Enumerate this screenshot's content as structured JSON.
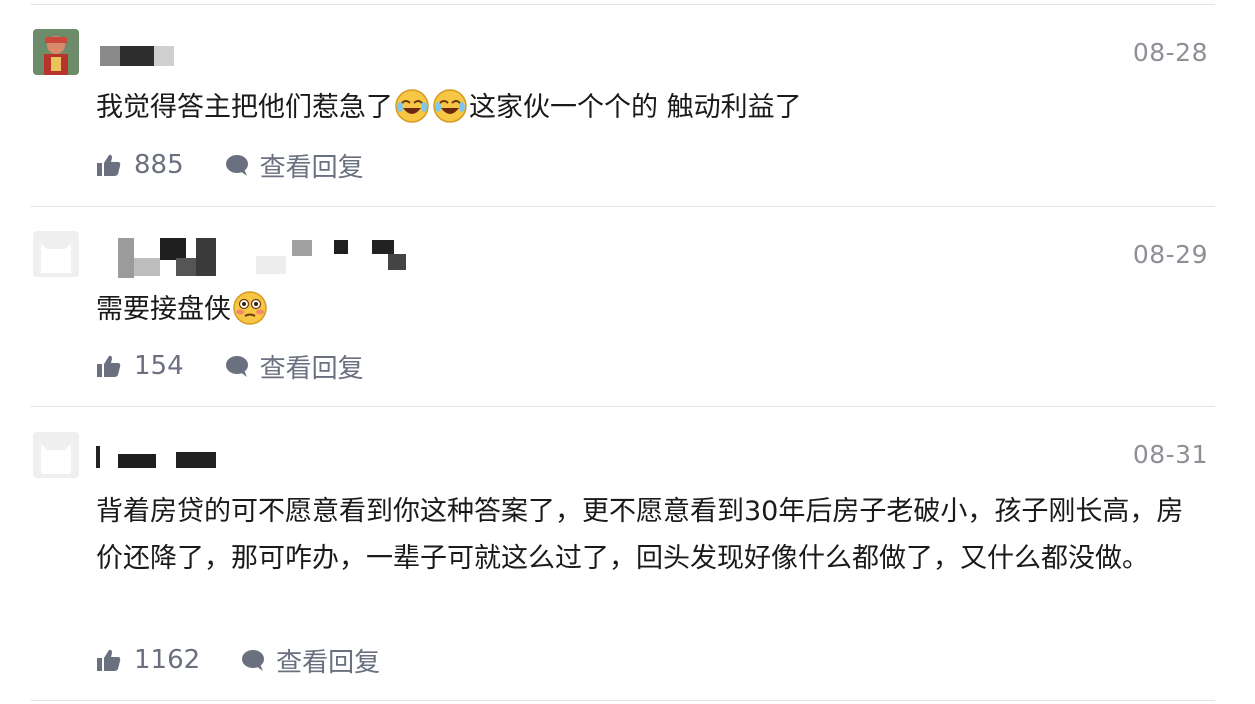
{
  "comments": [
    {
      "date": "08-28",
      "text_before": "我觉得答主把他们惹急了",
      "emojis": [
        "laugh-cry-emoji",
        "laugh-cry-emoji"
      ],
      "text_after": "这家伙一个个的 触动利益了",
      "likes": "885",
      "reply_label": "查看回复"
    },
    {
      "date": "08-29",
      "text_before": "需要接盘侠",
      "emojis": [
        "flushed-emoji"
      ],
      "text_after": "",
      "likes": "154",
      "reply_label": "查看回复"
    },
    {
      "date": "08-31",
      "text_before": "背着房贷的可不愿意看到你这种答案了，更不愿意看到30年后房子老破小，孩子刚长高，房价还降了，那可咋办，一辈子可就这么过了，回头发现好像什么都做了，又什么都没做。",
      "emojis": [],
      "text_after": "",
      "likes": "1162",
      "reply_label": "查看回复"
    }
  ],
  "colors": {
    "meta_gray": "#8e9097",
    "action_gray": "#6b7080",
    "text": "#1a1a1a",
    "divider": "#e6e6e6"
  }
}
